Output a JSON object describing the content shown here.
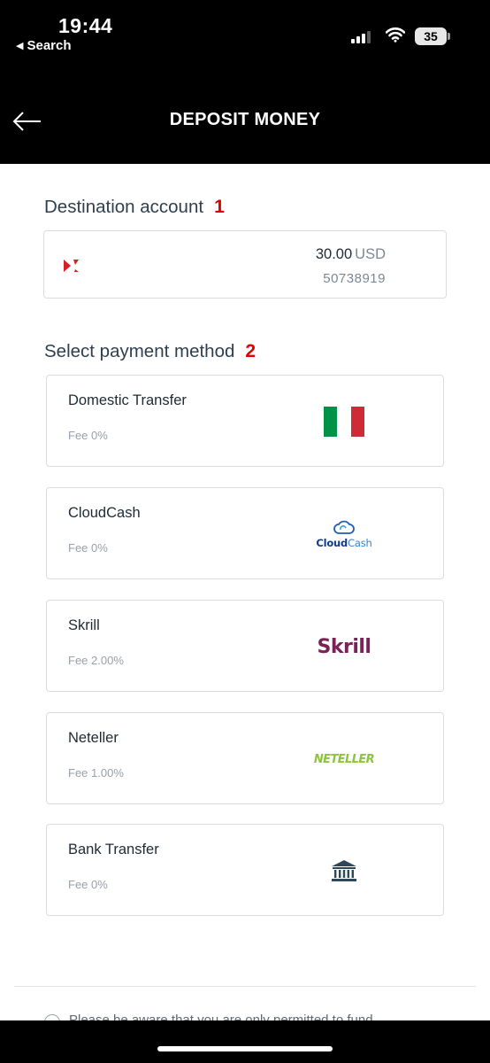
{
  "status_bar": {
    "time": "19:44",
    "back_app": "Search",
    "battery": "35"
  },
  "header": {
    "title": "DEPOSIT MONEY",
    "back_icon": "arrow-left-icon"
  },
  "destination": {
    "title": "Destination account",
    "step": "1",
    "account": {
      "amount": "30.00",
      "currency": "USD",
      "number": "50738919",
      "logo_color": "#d81f26"
    }
  },
  "payment": {
    "title": "Select payment method",
    "step": "2",
    "methods": [
      {
        "name": "Domestic Transfer",
        "fee": "Fee 0%",
        "logo": "italy-flag-icon"
      },
      {
        "name": "CloudCash",
        "fee": "Fee 0%",
        "logo": "cloudcash-logo",
        "logo_text_bold": "Cloud",
        "logo_text_light": "Cash"
      },
      {
        "name": "Skrill",
        "fee": "Fee 2.00%",
        "logo": "skrill-logo",
        "logo_text": "Skrill"
      },
      {
        "name": "Neteller",
        "fee": "Fee 1.00%",
        "logo": "neteller-logo",
        "logo_text": "NETELLER"
      },
      {
        "name": "Bank Transfer",
        "fee": "Fee 0%",
        "logo": "bank-icon"
      }
    ]
  },
  "consent": {
    "text": "Please be aware that you are only permitted to fund"
  },
  "colors": {
    "accent_step": "#e00000",
    "title_text": "#2f3f4f",
    "flag_green": "#009246",
    "flag_red": "#ce2b37",
    "skrill": "#7a2155",
    "neteller": "#8bc53f"
  }
}
